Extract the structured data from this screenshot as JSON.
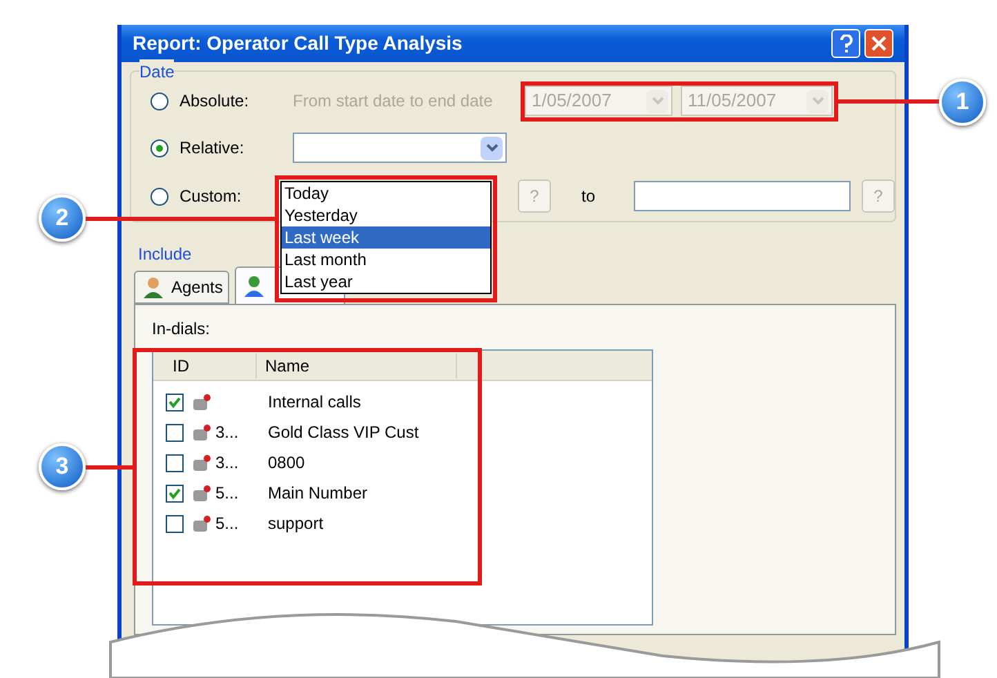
{
  "window": {
    "title": "Report: Operator Call Type Analysis"
  },
  "date_group": {
    "label": "Date",
    "options": [
      {
        "label": "Absolute:",
        "selected": false
      },
      {
        "label": "Relative:",
        "selected": true
      },
      {
        "label": "Custom:",
        "selected": false
      }
    ],
    "absolute_hint": "From start date to end date",
    "start_date": "1/05/2007",
    "end_date": "11/05/2007",
    "help_button": "?",
    "to_label": "to",
    "help_button_2": "?"
  },
  "relative_list": [
    {
      "label": "Today",
      "selected": false
    },
    {
      "label": "Yesterday",
      "selected": false
    },
    {
      "label": "Last week",
      "selected": true
    },
    {
      "label": "Last month",
      "selected": false
    },
    {
      "label": "Last year",
      "selected": false
    }
  ],
  "include_group": {
    "label": "Include",
    "tabs": [
      {
        "label": "Agents",
        "selected": false
      },
      {
        "selected": true
      }
    ]
  },
  "indials": {
    "label": "In-dials:",
    "columns": [
      "ID",
      "Name"
    ],
    "rows": [
      {
        "id": "",
        "name": "Internal calls",
        "checked": true
      },
      {
        "id": "3...",
        "name": "Gold Class VIP Cust",
        "checked": false
      },
      {
        "id": "3...",
        "name": "0800",
        "checked": false
      },
      {
        "id": "5...",
        "name": "Main Number",
        "checked": true
      },
      {
        "id": "5...",
        "name": "support",
        "checked": false
      }
    ]
  },
  "callouts": [
    "1",
    "2",
    "3"
  ]
}
